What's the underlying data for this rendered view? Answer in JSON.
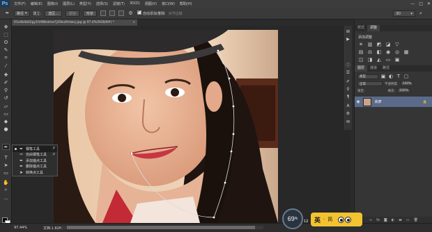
{
  "app": {
    "logo": "Ps",
    "menu": [
      "文件(F)",
      "编辑(E)",
      "图像(I)",
      "图层(L)",
      "类型(Y)",
      "选择(S)",
      "滤镜(T)",
      "3D(D)",
      "视图(V)",
      "窗口(W)",
      "帮助(H)"
    ],
    "window_controls": [
      "—",
      "□",
      "✕"
    ]
  },
  "options_bar": {
    "mode": "路径",
    "make_label": "建立:",
    "selection_btn": "选区...",
    "mask_btn": "蒙版",
    "shape_btn": "形状",
    "auto_add_delete": "自动添加/删除",
    "align_edges": "对齐边缘",
    "workspace": "3D"
  },
  "document": {
    "tab_title": "61e4b4b02gy1fe98bdmw7j20ku0hdwsj.jpg @ 97.4%(RGB/8#) *",
    "close": "×"
  },
  "flyout": {
    "items": [
      {
        "label": "钢笔工具",
        "key": "P",
        "icon": "pen-icon",
        "selected": true
      },
      {
        "label": "自由钢笔工具",
        "key": "P",
        "icon": "freeform-pen-icon",
        "selected": false
      },
      {
        "label": "添加锚点工具",
        "key": "",
        "icon": "add-anchor-icon",
        "selected": false
      },
      {
        "label": "删除锚点工具",
        "key": "",
        "icon": "delete-anchor-icon",
        "selected": false
      },
      {
        "label": "转换点工具",
        "key": "",
        "icon": "convert-point-icon",
        "selected": false
      }
    ]
  },
  "adjustments": {
    "tabs": [
      "样式",
      "调整"
    ],
    "title": "添加调整"
  },
  "layers": {
    "tabs": [
      "图层",
      "通道",
      "路径"
    ],
    "kind_label": "类型",
    "blend_mode": "正常",
    "opacity_label": "不透明度:",
    "opacity_value": "100%",
    "lock_label": "锁定:",
    "fill_label": "填充:",
    "fill_value": "100%",
    "layer_name": "背景"
  },
  "status": {
    "zoom": "97.44%",
    "doc_size": "文档:1.82M/1.82M"
  },
  "overlay": {
    "cpu_percent": "69",
    "cpu_unit": "%",
    "cpu_small": "12",
    "ime_text": "英",
    "ime_extra": "·",
    "ime_icon": "简"
  },
  "colors": {
    "ime_yellow": "#f2c231",
    "layer_selected": "#5a6a88",
    "green_button": "#3cb84a"
  }
}
